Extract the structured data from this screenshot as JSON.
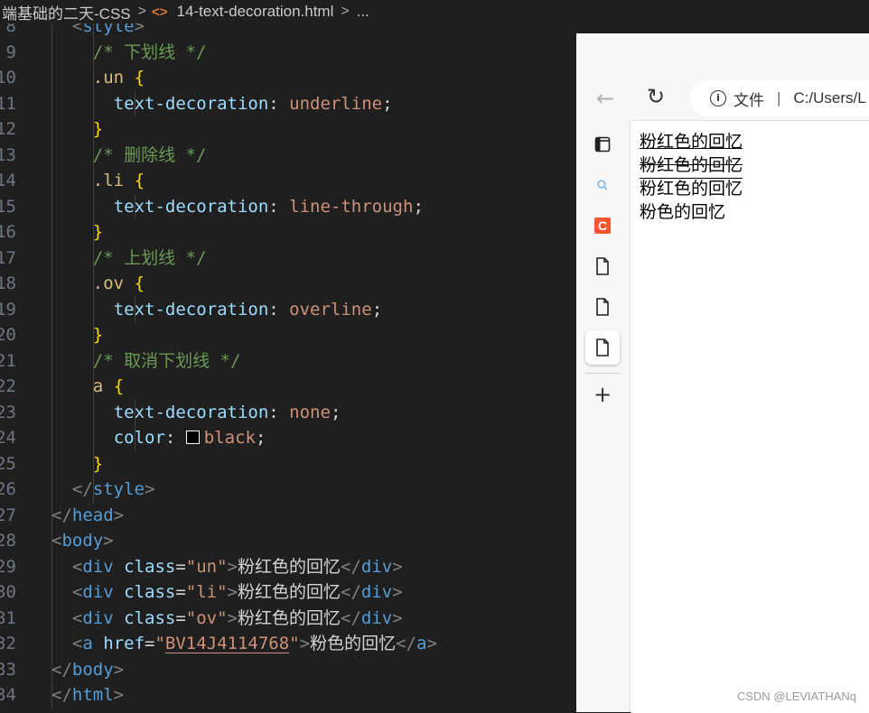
{
  "breadcrumb": {
    "folder": "端基础的二天-CSS",
    "file": "14-text-decoration.html",
    "more": "..."
  },
  "editor": {
    "lines": [
      {
        "n": "8",
        "tokens": [
          [
            "punc",
            "<"
          ],
          [
            "tag",
            "style"
          ],
          [
            "punc",
            ">"
          ]
        ]
      },
      {
        "n": "9",
        "tokens": [
          [
            "comment",
            "/* 下划线 */"
          ]
        ]
      },
      {
        "n": "10",
        "tokens": [
          [
            "sel",
            ".un "
          ],
          [
            "brace",
            "{"
          ]
        ]
      },
      {
        "n": "11",
        "tokens": [
          [
            "prop",
            "text-decoration"
          ],
          [
            "white",
            ": "
          ],
          [
            "val",
            "underline"
          ],
          [
            "white",
            ";"
          ]
        ]
      },
      {
        "n": "12",
        "tokens": [
          [
            "brace",
            "}"
          ]
        ]
      },
      {
        "n": "13",
        "tokens": [
          [
            "comment",
            "/* 删除线 */"
          ]
        ]
      },
      {
        "n": "14",
        "tokens": [
          [
            "sel",
            ".li "
          ],
          [
            "brace",
            "{"
          ]
        ]
      },
      {
        "n": "15",
        "tokens": [
          [
            "prop",
            "text-decoration"
          ],
          [
            "white",
            ": "
          ],
          [
            "val",
            "line-through"
          ],
          [
            "white",
            ";"
          ]
        ]
      },
      {
        "n": "16",
        "tokens": [
          [
            "brace",
            "}"
          ]
        ]
      },
      {
        "n": "17",
        "tokens": [
          [
            "comment",
            "/* 上划线 */"
          ]
        ]
      },
      {
        "n": "18",
        "tokens": [
          [
            "sel",
            ".ov "
          ],
          [
            "brace",
            "{"
          ]
        ]
      },
      {
        "n": "19",
        "tokens": [
          [
            "prop",
            "text-decoration"
          ],
          [
            "white",
            ": "
          ],
          [
            "val",
            "overline"
          ],
          [
            "white",
            ";"
          ]
        ]
      },
      {
        "n": "20",
        "tokens": [
          [
            "brace",
            "}"
          ]
        ]
      },
      {
        "n": "21",
        "tokens": [
          [
            "comment",
            "/* 取消下划线 */"
          ]
        ]
      },
      {
        "n": "22",
        "tokens": [
          [
            "sel",
            "a "
          ],
          [
            "brace",
            "{"
          ]
        ]
      },
      {
        "n": "23",
        "tokens": [
          [
            "prop",
            "text-decoration"
          ],
          [
            "white",
            ": "
          ],
          [
            "val",
            "none"
          ],
          [
            "white",
            ";"
          ]
        ]
      },
      {
        "n": "24",
        "tokens": [
          [
            "prop",
            "color"
          ],
          [
            "white",
            ": "
          ],
          [
            "swatch",
            "#000000"
          ],
          [
            "val",
            "black"
          ],
          [
            "white",
            ";"
          ]
        ]
      },
      {
        "n": "25",
        "tokens": [
          [
            "brace",
            "}"
          ]
        ]
      },
      {
        "n": "26",
        "tokens": [
          [
            "punc",
            "</"
          ],
          [
            "tag",
            "style"
          ],
          [
            "punc",
            ">"
          ]
        ]
      },
      {
        "n": "27",
        "tokens": [
          [
            "punc",
            "</"
          ],
          [
            "tag",
            "head"
          ],
          [
            "punc",
            ">"
          ]
        ]
      },
      {
        "n": "28",
        "tokens": [
          [
            "punc",
            "<"
          ],
          [
            "tag",
            "body"
          ],
          [
            "punc",
            ">"
          ]
        ]
      },
      {
        "n": "29",
        "tokens": [
          [
            "punc",
            "<"
          ],
          [
            "tag",
            "div"
          ],
          [
            "white",
            " "
          ],
          [
            "attr",
            "class"
          ],
          [
            "white",
            "="
          ],
          [
            "str",
            "\"un\""
          ],
          [
            "punc",
            ">"
          ],
          [
            "text",
            "粉红色的回忆"
          ],
          [
            "punc",
            "</"
          ],
          [
            "tag",
            "div"
          ],
          [
            "punc",
            ">"
          ]
        ]
      },
      {
        "n": "30",
        "tokens": [
          [
            "punc",
            "<"
          ],
          [
            "tag",
            "div"
          ],
          [
            "white",
            " "
          ],
          [
            "attr",
            "class"
          ],
          [
            "white",
            "="
          ],
          [
            "str",
            "\"li\""
          ],
          [
            "punc",
            ">"
          ],
          [
            "text",
            "粉红色的回忆"
          ],
          [
            "punc",
            "</"
          ],
          [
            "tag",
            "div"
          ],
          [
            "punc",
            ">"
          ]
        ]
      },
      {
        "n": "31",
        "tokens": [
          [
            "punc",
            "<"
          ],
          [
            "tag",
            "div"
          ],
          [
            "white",
            " "
          ],
          [
            "attr",
            "class"
          ],
          [
            "white",
            "="
          ],
          [
            "str",
            "\"ov\""
          ],
          [
            "punc",
            ">"
          ],
          [
            "text",
            "粉红色的回忆"
          ],
          [
            "punc",
            "</"
          ],
          [
            "tag",
            "div"
          ],
          [
            "punc",
            ">"
          ]
        ]
      },
      {
        "n": "32",
        "tokens": [
          [
            "punc",
            "<"
          ],
          [
            "tag",
            "a"
          ],
          [
            "white",
            " "
          ],
          [
            "attr",
            "href"
          ],
          [
            "white",
            "="
          ],
          [
            "str",
            "\""
          ],
          [
            "strU",
            "BV14J4114768"
          ],
          [
            "str",
            "\""
          ],
          [
            "punc",
            ">"
          ],
          [
            "text",
            "粉色的回忆"
          ],
          [
            "punc",
            "</"
          ],
          [
            "tag",
            "a"
          ],
          [
            "punc",
            ">"
          ]
        ]
      },
      {
        "n": "33",
        "tokens": [
          [
            "punc",
            "</"
          ],
          [
            "tag",
            "body"
          ],
          [
            "punc",
            ">"
          ]
        ]
      },
      {
        "n": "34",
        "tokens": [
          [
            "punc",
            "</"
          ],
          [
            "tag",
            "html"
          ],
          [
            "punc",
            ">"
          ]
        ]
      }
    ]
  },
  "browser": {
    "address_label": "文件",
    "address_url": "C:/Users/L",
    "page_lines": [
      "粉红色的回忆",
      "粉红色的回忆",
      "粉红色的回忆",
      "粉色的回忆"
    ]
  },
  "watermark": "CSDN @LEVIATHANq"
}
